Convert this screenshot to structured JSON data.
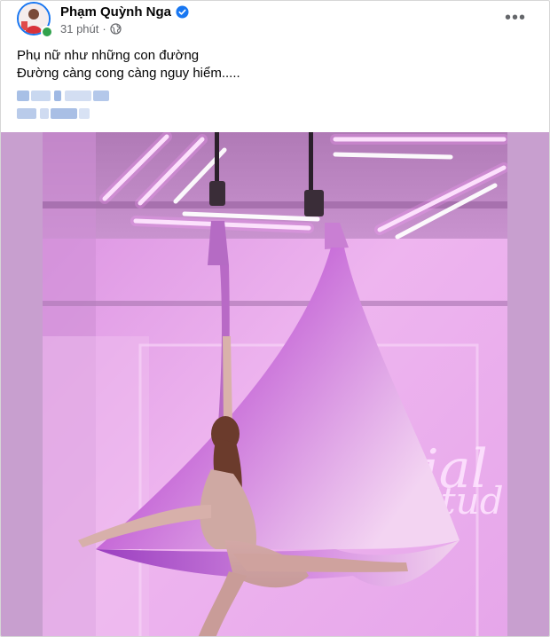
{
  "post": {
    "author": "Phạm Quỳnh Nga",
    "time": "31 phút",
    "separator": "·",
    "privacy_icon": "globe-icon",
    "verified_icon": "verified-badge-icon",
    "more_label": "•••",
    "text_lines": [
      "Phụ nữ như những con đường",
      "Đường càng cong càng nguy hiểm....."
    ]
  },
  "colors": {
    "verified": "#1877f2",
    "online": "#31a24c",
    "secondary_text": "#65676b",
    "media_bg": "#c89fcf",
    "silk_purple": "#9b3fc0",
    "room_pink": "#e6a6ea"
  },
  "media": {
    "type": "photo",
    "subject": "woman posing on purple aerial silk hammock in a pink neon-lit studio",
    "wall_sign": "Aerial Studio"
  }
}
